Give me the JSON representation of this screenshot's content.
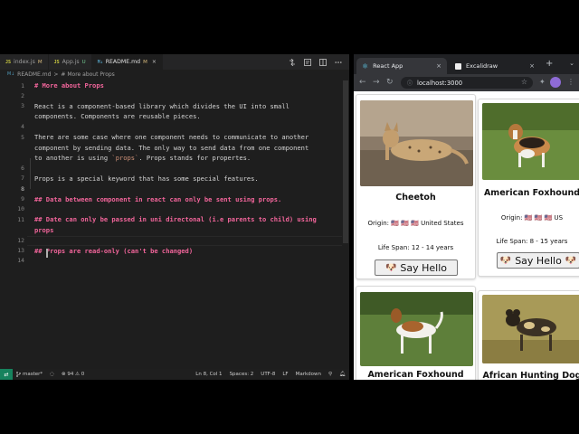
{
  "vscode": {
    "tabs": [
      {
        "type": "JS",
        "name": "index.js",
        "badge": "M"
      },
      {
        "type": "JS",
        "name": "App.js",
        "badge": "U"
      },
      {
        "type": "M↓",
        "name": "README.md",
        "badge": "M",
        "active": true
      }
    ],
    "breadcrumb": {
      "file": "README.md",
      "separator": ">",
      "section": "# More about Props"
    },
    "lines": [
      {
        "n": "1",
        "text": "# More about Props",
        "heading": true
      },
      {
        "n": "2",
        "text": ""
      },
      {
        "n": "3",
        "text": "React is a component-based library which divides the UI into small"
      },
      {
        "n": "",
        "text": "components. Components are reusable pieces."
      },
      {
        "n": "4",
        "text": ""
      },
      {
        "n": "5",
        "text": "There are some case where one component needs to communicate to another"
      },
      {
        "n": "",
        "text": "component by sending data. The only way to send data from one component"
      },
      {
        "n": "",
        "text": "to another is using `props`. Props stands for propertes.",
        "code": "`props`"
      },
      {
        "n": "6",
        "text": ""
      },
      {
        "n": "7",
        "text": "Props is a special keyword that has some special features."
      },
      {
        "n": "8",
        "text": "",
        "current": true
      },
      {
        "n": "9",
        "text": "## Data between component in react can only be sent using props.",
        "heading": true
      },
      {
        "n": "10",
        "text": ""
      },
      {
        "n": "11",
        "text": "## Date can only be passed in uni directonal (i.e parents to child) using",
        "heading": true
      },
      {
        "n": "",
        "text": "props",
        "heading": true
      },
      {
        "n": "12",
        "text": ""
      },
      {
        "n": "13",
        "text": "## Props are read-only (can't be changed)",
        "heading": true
      },
      {
        "n": "14",
        "text": ""
      }
    ],
    "status": {
      "branch": "master*",
      "problems": "⊗ 94 ⚠ 0",
      "position": "Ln 8, Col 1",
      "spaces": "Spaces: 2",
      "encoding": "UTF-8",
      "eol": "LF",
      "language": "Markdown"
    }
  },
  "browser": {
    "tabs": [
      {
        "title": "React App",
        "close": "×"
      },
      {
        "title": "Excalidraw",
        "close": "×"
      }
    ],
    "new_tab": "+",
    "url": "localhost:3000",
    "cards": [
      {
        "name": "Cheetoh",
        "origin": "Origin: 🇺🇸 🇺🇸 🇺🇸 United States",
        "lifespan": "Life Span: 12 - 14 years",
        "button": "Say Hello",
        "dog": "🐶"
      },
      {
        "name": "American Foxhound",
        "origin": "Origin: 🇺🇸 🇺🇸 🇺🇸 US",
        "lifespan": "Life Span: 8 - 15 years",
        "button": "Say Hello",
        "dog": "🐶"
      },
      {
        "name": "American Foxhound"
      },
      {
        "name": "African Hunting Dog"
      }
    ]
  },
  "colors": {
    "editor_bg": "#1e1e1e",
    "heading": "#f2659b",
    "inline_code": "#ce9178",
    "status_remote": "#16825d"
  }
}
